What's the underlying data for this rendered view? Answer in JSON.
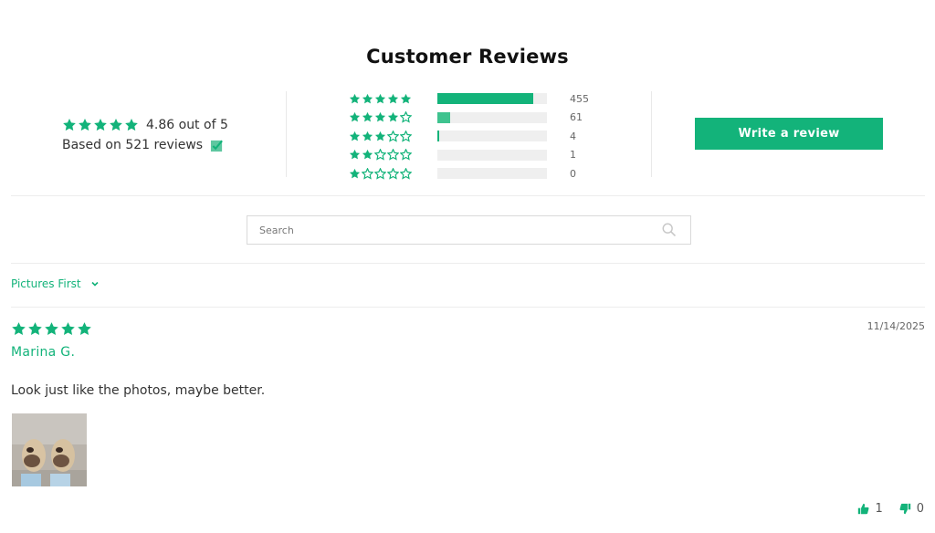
{
  "title": "Customer Reviews",
  "summary": {
    "average_text": "4.86 out of 5",
    "based_on_text": "Based on 521 reviews",
    "stars": 5
  },
  "histogram": [
    {
      "stars": 5,
      "count": "455",
      "fraction": 0.873
    },
    {
      "stars": 4,
      "count": "61",
      "fraction": 0.117
    },
    {
      "stars": 3,
      "count": "4",
      "fraction": 0.012
    },
    {
      "stars": 2,
      "count": "1",
      "fraction": 0
    },
    {
      "stars": 1,
      "count": "0",
      "fraction": 0
    }
  ],
  "write_review_label": "Write a review",
  "search": {
    "placeholder": "Search",
    "value": ""
  },
  "sort": {
    "selected": "Pictures First"
  },
  "review": {
    "stars": 5,
    "date": "11/14/2025",
    "author": "Marina G.",
    "body": "Look just like the photos, maybe better.",
    "helpful_yes": "1",
    "helpful_no": "0"
  },
  "colors": {
    "accent": "#13b37a",
    "track": "#efefef"
  },
  "icons": {
    "star": "star-icon",
    "verified": "verified-check-icon",
    "search": "search-icon",
    "chevron": "chevron-down-icon",
    "thumbs_up": "thumbs-up-icon",
    "thumbs_down": "thumbs-down-icon"
  }
}
